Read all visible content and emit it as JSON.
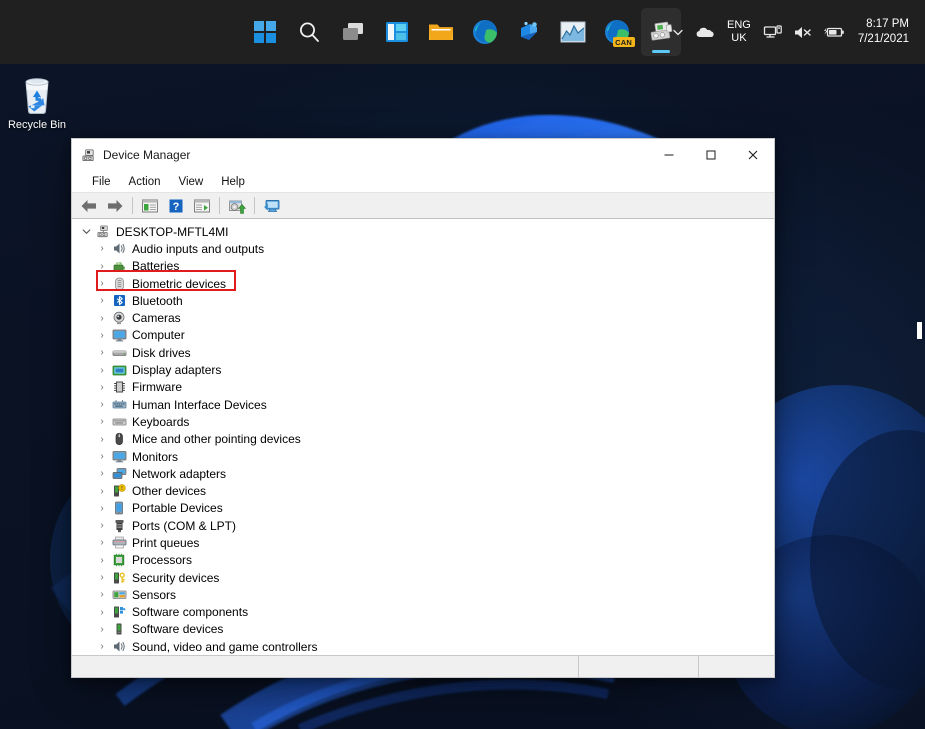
{
  "desktop": {
    "recycle_bin": {
      "label": "Recycle Bin",
      "icon": "recycle-bin-icon"
    },
    "wallpaper_name": "windows-11-bloom"
  },
  "taskbar": {
    "items": [
      {
        "name": "start-button",
        "icon": "windows-logo-icon",
        "label": "Start",
        "active": false
      },
      {
        "name": "search-button",
        "icon": "search-icon",
        "label": "Search",
        "active": false
      },
      {
        "name": "task-view-button",
        "icon": "task-view-icon",
        "label": "Task View",
        "active": false
      },
      {
        "name": "widgets-button",
        "icon": "widgets-icon",
        "label": "Widgets",
        "active": false
      },
      {
        "name": "file-explorer-button",
        "icon": "folder-icon",
        "label": "File Explorer",
        "active": false
      },
      {
        "name": "edge-button",
        "icon": "edge-icon",
        "label": "Microsoft Edge",
        "active": false
      },
      {
        "name": "teams-button",
        "icon": "chat-icon",
        "label": "Chat",
        "active": false
      },
      {
        "name": "charts-app-button",
        "icon": "chart-icon",
        "label": "Charts",
        "active": false
      },
      {
        "name": "edge-canary-button",
        "icon": "edge-canary-icon",
        "label": "Edge Canary",
        "badge": "CAN",
        "active": false
      },
      {
        "name": "device-manager-button",
        "icon": "device-manager-icon",
        "label": "Device Manager",
        "active": true
      }
    ],
    "tray": {
      "chevron": {
        "name": "show-hidden-icons-icon",
        "glyph": "⌄"
      },
      "onedrive": {
        "name": "onedrive-cloud-icon"
      },
      "language": {
        "name": "language-indicator",
        "line1": "ENG",
        "line2": "UK"
      },
      "network": {
        "name": "network-icon"
      },
      "volume": {
        "name": "volume-muted-icon"
      },
      "battery": {
        "name": "battery-icon"
      },
      "clock": {
        "time": "8:17 PM",
        "date": "7/21/2021"
      }
    }
  },
  "window": {
    "title": "Device Manager",
    "title_icon": "device-manager-icon",
    "controls": {
      "minimize": {
        "name": "minimize-button",
        "glyph": "–"
      },
      "maximize": {
        "name": "maximize-button",
        "glyph": "□"
      },
      "close": {
        "name": "close-button",
        "glyph": "✕"
      }
    },
    "menu": [
      {
        "name": "menu-file",
        "label": "File"
      },
      {
        "name": "menu-action",
        "label": "Action"
      },
      {
        "name": "menu-view",
        "label": "View"
      },
      {
        "name": "menu-help",
        "label": "Help"
      }
    ],
    "toolbar": [
      {
        "name": "back-button",
        "icon": "back-arrow-icon",
        "tooltip": "Back"
      },
      {
        "name": "forward-button",
        "icon": "forward-arrow-icon",
        "tooltip": "Forward"
      },
      {
        "name": "separator-1",
        "icon": "separator"
      },
      {
        "name": "show-console-tree-button",
        "icon": "console-tree-icon",
        "tooltip": "Show/Hide Console Tree"
      },
      {
        "name": "help-button",
        "icon": "help-question-icon",
        "tooltip": "Help"
      },
      {
        "name": "properties-button",
        "icon": "properties-icon",
        "tooltip": "Properties"
      },
      {
        "name": "separator-2",
        "icon": "separator"
      },
      {
        "name": "update-driver-button",
        "icon": "update-driver-icon",
        "tooltip": "Update Driver Software"
      },
      {
        "name": "separator-3",
        "icon": "separator"
      },
      {
        "name": "scan-hardware-changes-button",
        "icon": "scan-hardware-icon",
        "tooltip": "Scan for hardware changes"
      }
    ],
    "tree": {
      "root": {
        "label": "DESKTOP-MFTL4MI",
        "icon": "computer-tree-icon",
        "expanded": true,
        "chevron": "⌄"
      },
      "children": [
        {
          "label": "Audio inputs and outputs",
          "icon": "speaker-icon"
        },
        {
          "label": "Batteries",
          "icon": "battery-device-icon"
        },
        {
          "label": "Biometric devices",
          "icon": "fingerprint-icon",
          "highlighted": true
        },
        {
          "label": "Bluetooth",
          "icon": "bluetooth-icon"
        },
        {
          "label": "Cameras",
          "icon": "camera-icon"
        },
        {
          "label": "Computer",
          "icon": "monitor-icon"
        },
        {
          "label": "Disk drives",
          "icon": "disk-drive-icon"
        },
        {
          "label": "Display adapters",
          "icon": "display-adapter-icon"
        },
        {
          "label": "Firmware",
          "icon": "firmware-chip-icon"
        },
        {
          "label": "Human Interface Devices",
          "icon": "hid-icon"
        },
        {
          "label": "Keyboards",
          "icon": "keyboard-icon"
        },
        {
          "label": "Mice and other pointing devices",
          "icon": "mouse-icon"
        },
        {
          "label": "Monitors",
          "icon": "monitor-icon"
        },
        {
          "label": "Network adapters",
          "icon": "network-adapter-icon"
        },
        {
          "label": "Other devices",
          "icon": "other-device-warning-icon"
        },
        {
          "label": "Portable Devices",
          "icon": "portable-device-icon"
        },
        {
          "label": "Ports (COM & LPT)",
          "icon": "port-icon"
        },
        {
          "label": "Print queues",
          "icon": "printer-icon"
        },
        {
          "label": "Processors",
          "icon": "processor-icon"
        },
        {
          "label": "Security devices",
          "icon": "security-key-icon"
        },
        {
          "label": "Sensors",
          "icon": "sensor-icon"
        },
        {
          "label": "Software components",
          "icon": "software-component-icon"
        },
        {
          "label": "Software devices",
          "icon": "software-device-icon"
        },
        {
          "label": "Sound, video and game controllers",
          "icon": "sound-controller-icon"
        }
      ],
      "child_chevron": "›"
    },
    "statusbar": {
      "pane1": "",
      "pane2": "",
      "pane3": ""
    }
  },
  "colors": {
    "accent": "#0078d4",
    "taskbar_bg": "#202020",
    "highlight_red": "#e01b1b",
    "window_bg": "#ffffff",
    "toolbar_bg": "#f0f0f0"
  }
}
